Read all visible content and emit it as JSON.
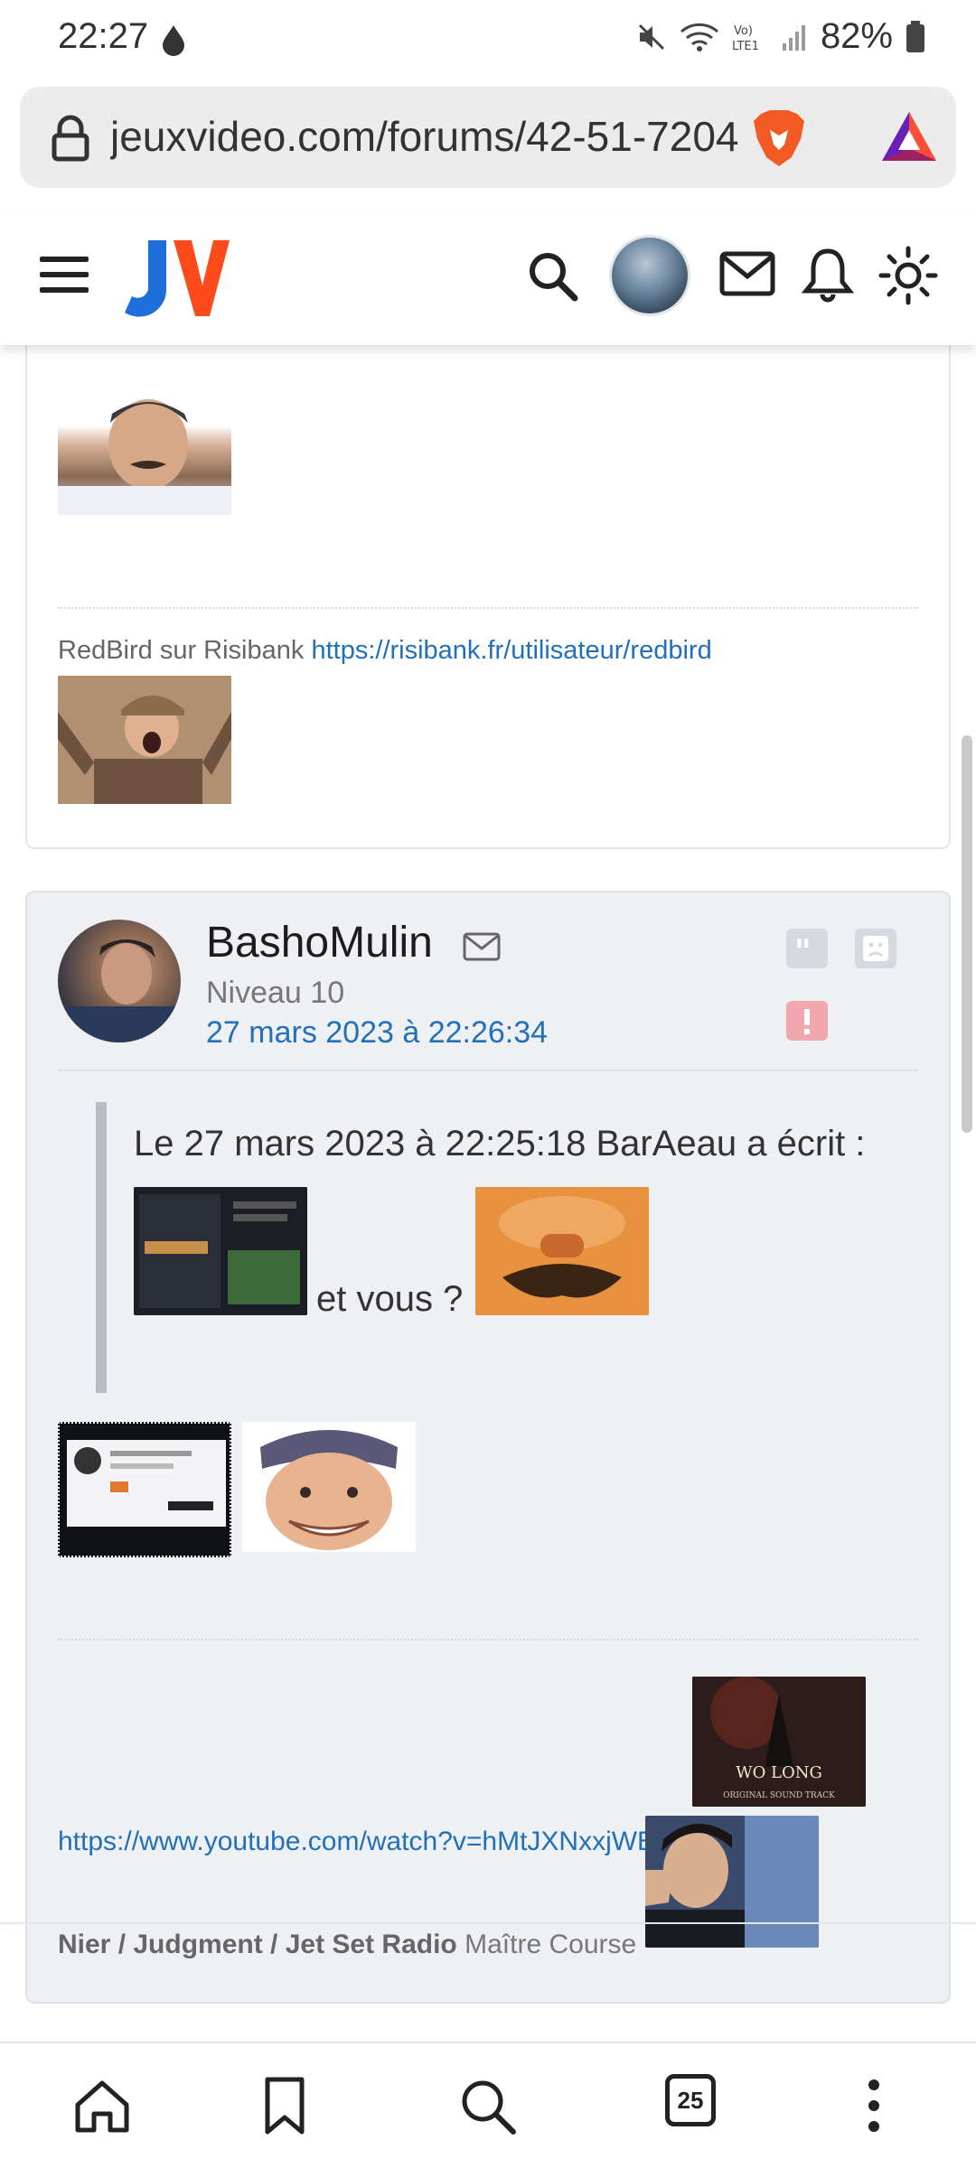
{
  "status_bar": {
    "time": "22:27",
    "battery": "82%",
    "icons": [
      "drop-icon",
      "mute-icon",
      "wifi-icon",
      "volte-icon",
      "signal-icon",
      "battery-icon"
    ]
  },
  "browser": {
    "url": "jeuxvideo.com/forums/42-51-7204",
    "tab_count": "25",
    "icons": [
      "lock-icon",
      "brave-lion-icon",
      "bat-rewards-icon"
    ]
  },
  "site_header": {
    "logo_text": "JV",
    "icons": [
      "menu-icon",
      "search-icon",
      "user-avatar",
      "mail-icon",
      "bell-icon",
      "theme-sun-icon"
    ]
  },
  "previous_post": {
    "signature_prefix": "RedBird sur Risibank",
    "signature_link": "https://risibank.fr/utilisateur/redbird"
  },
  "post": {
    "author": "BashoMulin",
    "level": "Niveau 10",
    "date": "27 mars 2023 à 22:26:34",
    "quote_header": "Le 27 mars 2023 à 22:25:18 BarAeau a écrit :",
    "quote_body": "et vous ?",
    "youtube_link": "https://www.youtube.com/watch?v=hMtJXNxxjWE",
    "signature": {
      "bold_part": "Nier / Judgment / Jet Set Radio",
      "rest": "Maître Course"
    },
    "images": [
      "sticker-screenshot",
      "sticker-risitas-face",
      "sticker-screenshot-2",
      "sticker-bandana-face",
      "wo-long-cover",
      "judgment-cover"
    ]
  },
  "colors": {
    "link": "#2270b8",
    "post_bg": "#eef0f4",
    "alert": "#f0a8ae"
  }
}
